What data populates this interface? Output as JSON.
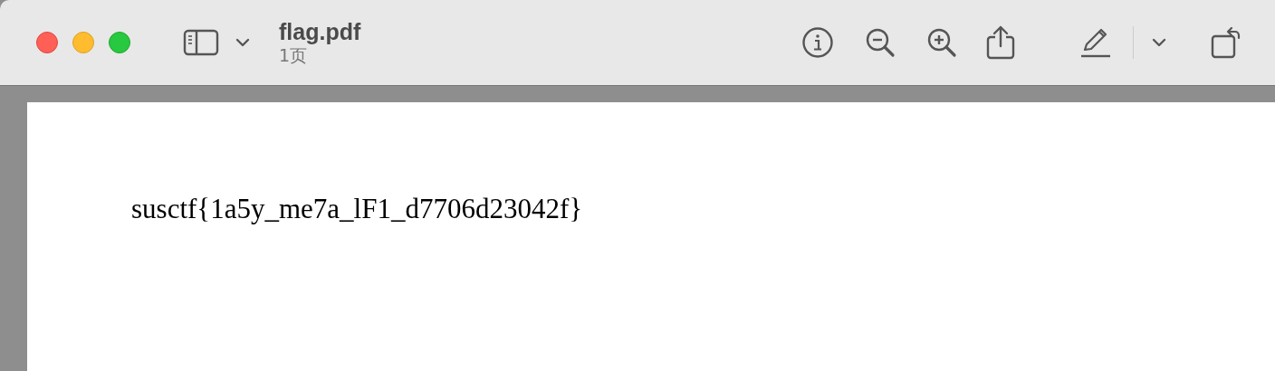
{
  "window": {
    "title": "flag.pdf",
    "subtitle": "1页"
  },
  "document": {
    "pages": [
      {
        "lines": [
          "susctf{1a5y_me7a_lF1_d7706d23042f}"
        ]
      }
    ]
  }
}
